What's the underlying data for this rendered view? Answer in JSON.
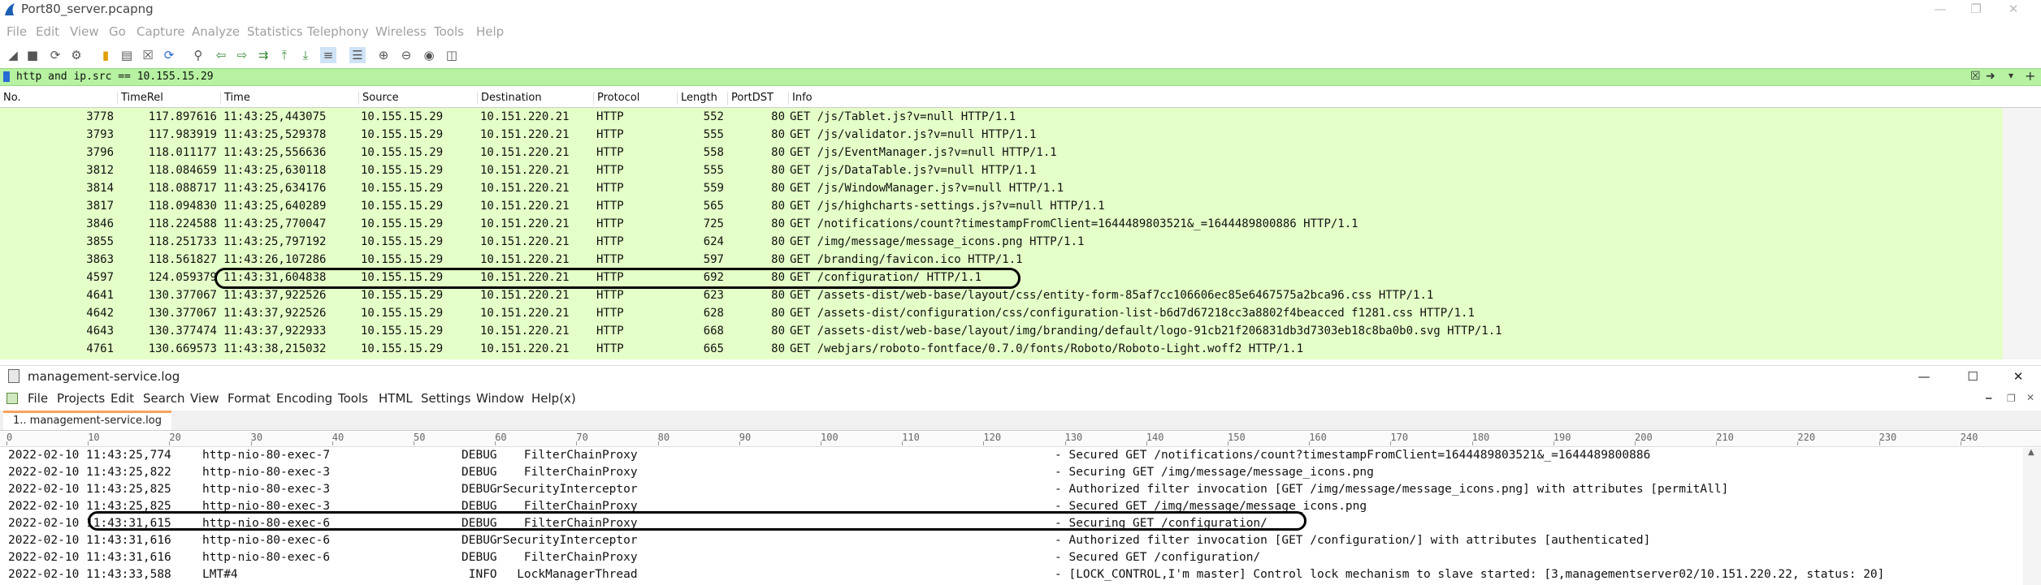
{
  "wireshark": {
    "title": "Port80_server.pcapng",
    "menu": [
      "File",
      "Edit",
      "View",
      "Go",
      "Capture",
      "Analyze",
      "Statistics",
      "Telephony",
      "Wireless",
      "Tools",
      "Help"
    ],
    "filter": "http and ip.src == 10.155.15.29",
    "columns": [
      "No.",
      "TimeRel",
      "Time",
      "Source",
      "Destination",
      "Protocol",
      "Length",
      "PortDST",
      "Info"
    ],
    "rows": [
      {
        "no": "3778",
        "timerel": "117.897616",
        "time": "11:43:25,443075",
        "src": "10.155.15.29",
        "dst": "10.151.220.21",
        "proto": "HTTP",
        "len": "552",
        "port": "80",
        "info": "GET /js/Tablet.js?v=null HTTP/1.1"
      },
      {
        "no": "3793",
        "timerel": "117.983919",
        "time": "11:43:25,529378",
        "src": "10.155.15.29",
        "dst": "10.151.220.21",
        "proto": "HTTP",
        "len": "555",
        "port": "80",
        "info": "GET /js/validator.js?v=null HTTP/1.1"
      },
      {
        "no": "3796",
        "timerel": "118.011177",
        "time": "11:43:25,556636",
        "src": "10.155.15.29",
        "dst": "10.151.220.21",
        "proto": "HTTP",
        "len": "558",
        "port": "80",
        "info": "GET /js/EventManager.js?v=null HTTP/1.1"
      },
      {
        "no": "3812",
        "timerel": "118.084659",
        "time": "11:43:25,630118",
        "src": "10.155.15.29",
        "dst": "10.151.220.21",
        "proto": "HTTP",
        "len": "555",
        "port": "80",
        "info": "GET /js/DataTable.js?v=null HTTP/1.1"
      },
      {
        "no": "3814",
        "timerel": "118.088717",
        "time": "11:43:25,634176",
        "src": "10.155.15.29",
        "dst": "10.151.220.21",
        "proto": "HTTP",
        "len": "559",
        "port": "80",
        "info": "GET /js/WindowManager.js?v=null HTTP/1.1"
      },
      {
        "no": "3817",
        "timerel": "118.094830",
        "time": "11:43:25,640289",
        "src": "10.155.15.29",
        "dst": "10.151.220.21",
        "proto": "HTTP",
        "len": "565",
        "port": "80",
        "info": "GET /js/highcharts-settings.js?v=null HTTP/1.1"
      },
      {
        "no": "3846",
        "timerel": "118.224588",
        "time": "11:43:25,770047",
        "src": "10.155.15.29",
        "dst": "10.151.220.21",
        "proto": "HTTP",
        "len": "725",
        "port": "80",
        "info": "GET /notifications/count?timestampFromClient=1644489803521&_=1644489800886 HTTP/1.1"
      },
      {
        "no": "3855",
        "timerel": "118.251733",
        "time": "11:43:25,797192",
        "src": "10.155.15.29",
        "dst": "10.151.220.21",
        "proto": "HTTP",
        "len": "624",
        "port": "80",
        "info": "GET /img/message/message_icons.png HTTP/1.1"
      },
      {
        "no": "3863",
        "timerel": "118.561827",
        "time": "11:43:26,107286",
        "src": "10.155.15.29",
        "dst": "10.151.220.21",
        "proto": "HTTP",
        "len": "597",
        "port": "80",
        "info": "GET /branding/favicon.ico HTTP/1.1"
      },
      {
        "no": "4597",
        "timerel": "124.059379",
        "time": "11:43:31,604838",
        "src": "10.155.15.29",
        "dst": "10.151.220.21",
        "proto": "HTTP",
        "len": "692",
        "port": "80",
        "info": "GET /configuration/ HTTP/1.1"
      },
      {
        "no": "4641",
        "timerel": "130.377067",
        "time": "11:43:37,922526",
        "src": "10.155.15.29",
        "dst": "10.151.220.21",
        "proto": "HTTP",
        "len": "623",
        "port": "80",
        "info": "GET /assets-dist/web-base/layout/css/entity-form-85af7cc106606ec85e6467575a2bca96.css HTTP/1.1"
      },
      {
        "no": "4642",
        "timerel": "130.377067",
        "time": "11:43:37,922526",
        "src": "10.155.15.29",
        "dst": "10.151.220.21",
        "proto": "HTTP",
        "len": "628",
        "port": "80",
        "info": "GET /assets-dist/configuration/css/configuration-list-b6d7d67218cc3a8802f4beacced f1281.css HTTP/1.1"
      },
      {
        "no": "4643",
        "timerel": "130.377474",
        "time": "11:43:37,922933",
        "src": "10.155.15.29",
        "dst": "10.151.220.21",
        "proto": "HTTP",
        "len": "668",
        "port": "80",
        "info": "GET /assets-dist/web-base/layout/img/branding/default/logo-91cb21f206831db3d7303eb18c8ba0b0.svg HTTP/1.1"
      },
      {
        "no": "4761",
        "timerel": "130.669573",
        "time": "11:43:38,215032",
        "src": "10.155.15.29",
        "dst": "10.151.220.21",
        "proto": "HTTP",
        "len": "665",
        "port": "80",
        "info": "GET /webjars/roboto-fontface/0.7.0/fonts/Roboto/Roboto-Light.woff2 HTTP/1.1"
      }
    ]
  },
  "notepad": {
    "title": "management-service.log",
    "menu": [
      "File",
      "Projects",
      "Edit",
      "Search",
      "View",
      "Format",
      "Encoding",
      "Tools",
      "HTML",
      "Settings",
      "Window",
      "Help(x)"
    ],
    "tab": "1.. management-service.log",
    "ruler": [
      "0",
      "10",
      "20",
      "30",
      "40",
      "50",
      "60",
      "70",
      "80",
      "90",
      "100",
      "110",
      "120",
      "130",
      "140",
      "150",
      "160",
      "170",
      "180",
      "190",
      "200",
      "210",
      "220",
      "230",
      "240"
    ],
    "lines": [
      {
        "ts": "2022-02-10 11:43:25,774",
        "thread": "http-nio-80-exec-7",
        "level": "DEBUG",
        "logger": "    FilterChainProxy",
        "msg": "- Secured GET /notifications/count?timestampFromClient=1644489803521&_=1644489800886"
      },
      {
        "ts": "2022-02-10 11:43:25,822",
        "thread": "http-nio-80-exec-3",
        "level": "DEBUG",
        "logger": "    FilterChainProxy",
        "msg": "- Securing GET /img/message/message_icons.png"
      },
      {
        "ts": "2022-02-10 11:43:25,825",
        "thread": "http-nio-80-exec-3",
        "level": "DEBUG",
        "logger": "rSecurityInterceptor",
        "msg": "- Authorized filter invocation [GET /img/message/message_icons.png] with attributes [permitAll]"
      },
      {
        "ts": "2022-02-10 11:43:25,825",
        "thread": "http-nio-80-exec-3",
        "level": "DEBUG",
        "logger": "    FilterChainProxy",
        "msg": "- Secured GET /img/message/message_icons.png"
      },
      {
        "ts": "2022-02-10 11:43:31,615",
        "thread": "http-nio-80-exec-6",
        "level": "DEBUG",
        "logger": "    FilterChainProxy",
        "msg": "- Securing GET /configuration/"
      },
      {
        "ts": "2022-02-10 11:43:31,616",
        "thread": "http-nio-80-exec-6",
        "level": "DEBUG",
        "logger": "rSecurityInterceptor",
        "msg": "- Authorized filter invocation [GET /configuration/] with attributes [authenticated]"
      },
      {
        "ts": "2022-02-10 11:43:31,616",
        "thread": "http-nio-80-exec-6",
        "level": "DEBUG",
        "logger": "    FilterChainProxy",
        "msg": "- Secured GET /configuration/"
      },
      {
        "ts": "2022-02-10 11:43:33,588",
        "thread": "LMT#4",
        "level": " INFO",
        "logger": "   LockManagerThread",
        "msg": "- [LOCK_CONTROL,I'm master] Control lock mechanism to slave started: [3,managementserver02/10.151.220.22, status: 20]"
      }
    ]
  }
}
